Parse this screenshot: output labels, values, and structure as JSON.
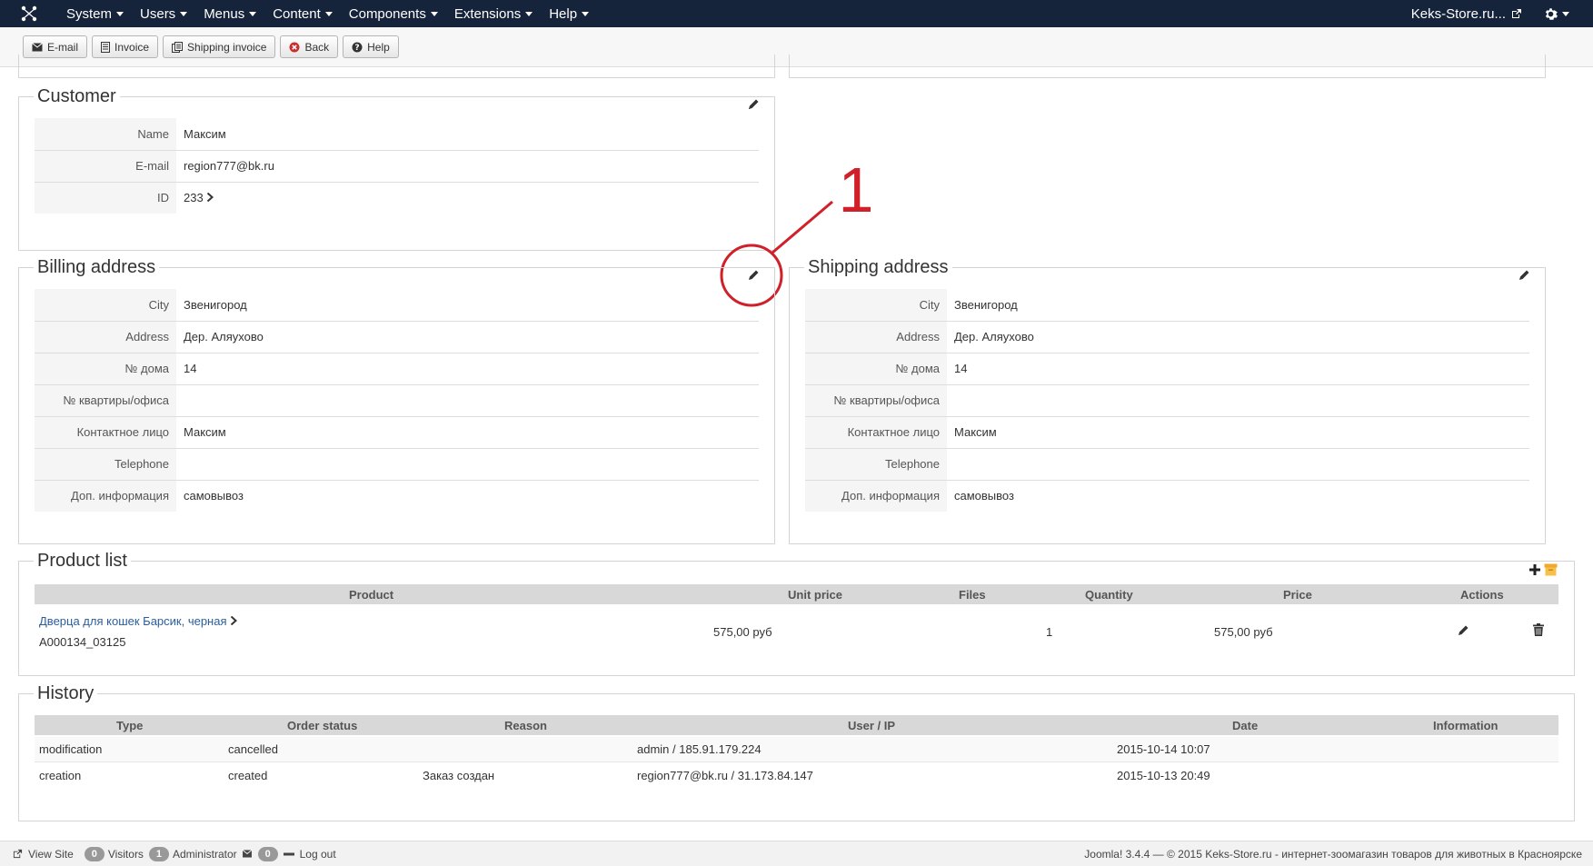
{
  "navbar": {
    "menu": [
      "System",
      "Users",
      "Menus",
      "Content",
      "Components",
      "Extensions",
      "Help"
    ],
    "site_link": "Keks-Store.ru..."
  },
  "toolbar": {
    "buttons": [
      "E-mail",
      "Invoice",
      "Shipping invoice",
      "Back",
      "Help"
    ]
  },
  "customer": {
    "legend": "Customer",
    "rows": [
      {
        "label": "Name",
        "value": "Максим"
      },
      {
        "label": "E-mail",
        "value": "region777@bk.ru"
      },
      {
        "label": "ID",
        "value": "233"
      }
    ]
  },
  "annotation": {
    "marker": "1",
    "color": "#d0202a"
  },
  "billing": {
    "legend": "Billing address",
    "rows": [
      {
        "label": "City",
        "value": "Звенигород"
      },
      {
        "label": "Address",
        "value": "Дер. Аляухово"
      },
      {
        "label": "№ дома",
        "value": "14"
      },
      {
        "label": "№ квартиры/офиса",
        "value": ""
      },
      {
        "label": "Контактное лицо",
        "value": "Максим"
      },
      {
        "label": "Telephone",
        "value": ""
      },
      {
        "label": "Доп. информация",
        "value": "самовывоз"
      }
    ]
  },
  "shipping": {
    "legend": "Shipping address",
    "rows": [
      {
        "label": "City",
        "value": "Звенигород"
      },
      {
        "label": "Address",
        "value": "Дер. Аляухово"
      },
      {
        "label": "№ дома",
        "value": "14"
      },
      {
        "label": "№ квартиры/офиса",
        "value": ""
      },
      {
        "label": "Контактное лицо",
        "value": "Максим"
      },
      {
        "label": "Telephone",
        "value": ""
      },
      {
        "label": "Доп. информация",
        "value": "самовывоз"
      }
    ]
  },
  "products": {
    "legend": "Product list",
    "headers": [
      "Product",
      "Unit price",
      "Files",
      "Quantity",
      "Price",
      "Actions"
    ],
    "items": [
      {
        "name": "Дверца для кошек Барсик, черная",
        "sku": "A000134_03125",
        "unit_price": "575,00 руб",
        "files": "",
        "quantity": "1",
        "price": "575,00 руб"
      }
    ]
  },
  "history": {
    "legend": "History",
    "headers": [
      "Type",
      "Order status",
      "Reason",
      "User / IP",
      "Date",
      "Information"
    ],
    "rows": [
      {
        "type": "modification",
        "status": "cancelled",
        "reason": "",
        "user": "admin / 185.91.179.224",
        "date": "2015-10-14 10:07",
        "info": ""
      },
      {
        "type": "creation",
        "status": "created",
        "reason": "Заказ создан",
        "user": "region777@bk.ru / 31.173.84.147",
        "date": "2015-10-13 20:49",
        "info": ""
      }
    ]
  },
  "footer": {
    "view_site": "View Site",
    "visitors_count": "0",
    "visitors": "Visitors",
    "admin_count": "1",
    "admin": "Administrator",
    "messages_count": "0",
    "logout": "Log out",
    "copyright": "Joomla! 3.4.4  —  © 2015 Keks-Store.ru - интернет-зоомагазин товаров для животных в Красноярске"
  }
}
